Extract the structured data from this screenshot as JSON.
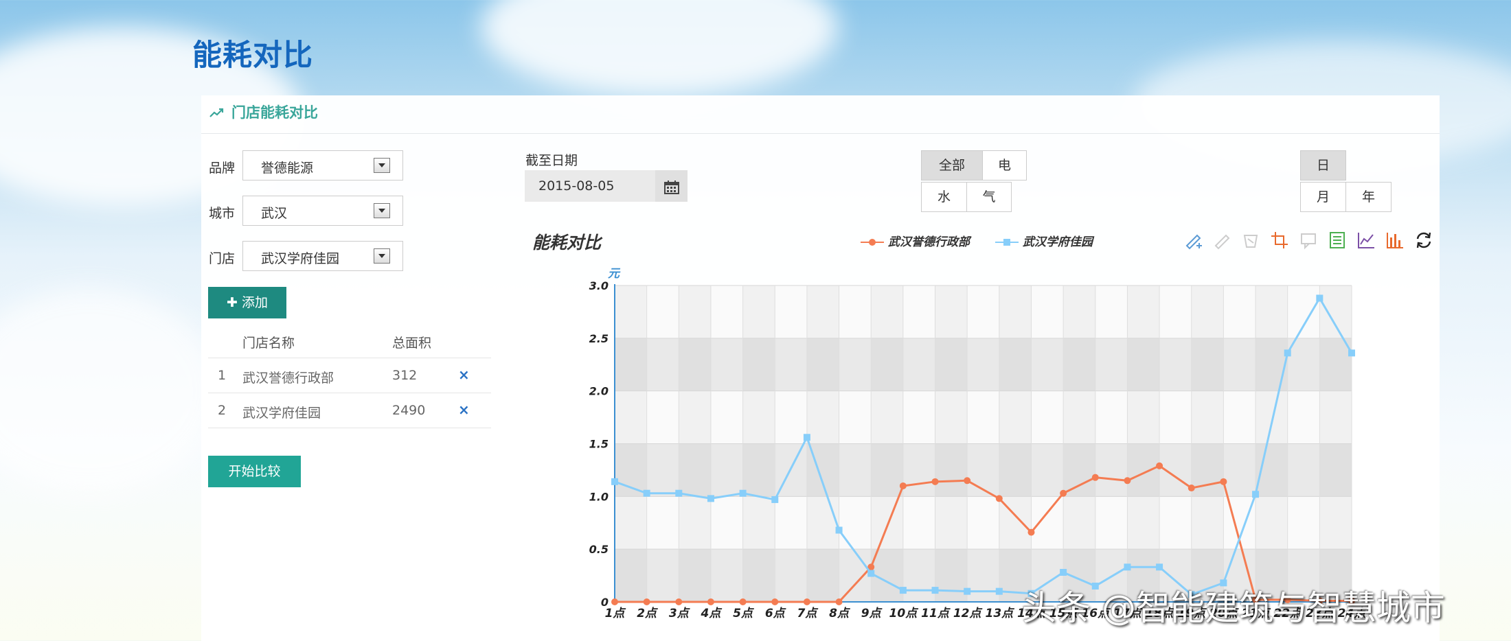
{
  "page": {
    "title": "能耗对比"
  },
  "panel": {
    "title": "门店能耗对比"
  },
  "filters": {
    "brand_label": "品牌",
    "brand_value": "誉德能源",
    "city_label": "城市",
    "city_value": "武汉",
    "store_label": "门店",
    "store_value": "武汉学府佳园",
    "add_button": "添加"
  },
  "store_table": {
    "headers": {
      "name": "门店名称",
      "area": "总面积"
    },
    "rows": [
      {
        "index": "1",
        "name": "武汉誉德行政部",
        "area": "312"
      },
      {
        "index": "2",
        "name": "武汉学府佳园",
        "area": "2490"
      }
    ],
    "delete_symbol": "×"
  },
  "compare_button": "开始比较",
  "date": {
    "label": "截至日期",
    "value": "2015-08-05"
  },
  "energy_type": {
    "all": "全部",
    "electric": "电",
    "water": "水",
    "gas": "气",
    "selected": "全部"
  },
  "period": {
    "day": "日",
    "month": "月",
    "year": "年",
    "selected": "日"
  },
  "toolbox_icons": [
    "dataZoom-icon",
    "dataZoom-reset-icon",
    "restore-icon",
    "dataView-icon",
    "line-icon",
    "bar-icon",
    "refresh-icon"
  ],
  "chart_data": {
    "type": "line",
    "title": "能耗对比",
    "ylabel": "元",
    "ylim": [
      0,
      3.0
    ],
    "y_ticks": [
      "0",
      "0.5",
      "1.0",
      "1.5",
      "2.0",
      "2.5",
      "3.0"
    ],
    "categories": [
      "1点",
      "2点",
      "3点",
      "4点",
      "5点",
      "6点",
      "7点",
      "8点",
      "9点",
      "10点",
      "11点",
      "12点",
      "13点",
      "14点",
      "15点",
      "16点",
      "17点",
      "18点",
      "19点",
      "20点",
      "21点",
      "22点",
      "23点",
      "24点"
    ],
    "legend_position": "top-right",
    "grid": true,
    "series": [
      {
        "name": "武汉誉德行政部",
        "color": "#f47c52",
        "marker": "circle",
        "values": [
          0,
          0,
          0,
          0,
          0,
          0,
          0,
          0,
          0.33,
          1.1,
          1.14,
          1.15,
          0.98,
          0.66,
          1.03,
          1.18,
          1.15,
          1.29,
          1.08,
          1.14,
          0.02,
          0.02,
          0.01,
          0.01
        ]
      },
      {
        "name": "武汉学府佳园",
        "color": "#87cefa",
        "marker": "square",
        "values": [
          1.14,
          1.03,
          1.03,
          0.98,
          1.03,
          0.97,
          1.56,
          0.68,
          0.27,
          0.11,
          0.11,
          0.1,
          0.1,
          0.08,
          0.28,
          0.15,
          0.33,
          0.33,
          0.07,
          0.18,
          1.02,
          2.36,
          2.88,
          2.36
        ]
      }
    ]
  },
  "watermark": "头条 @智能建筑与智慧城市"
}
